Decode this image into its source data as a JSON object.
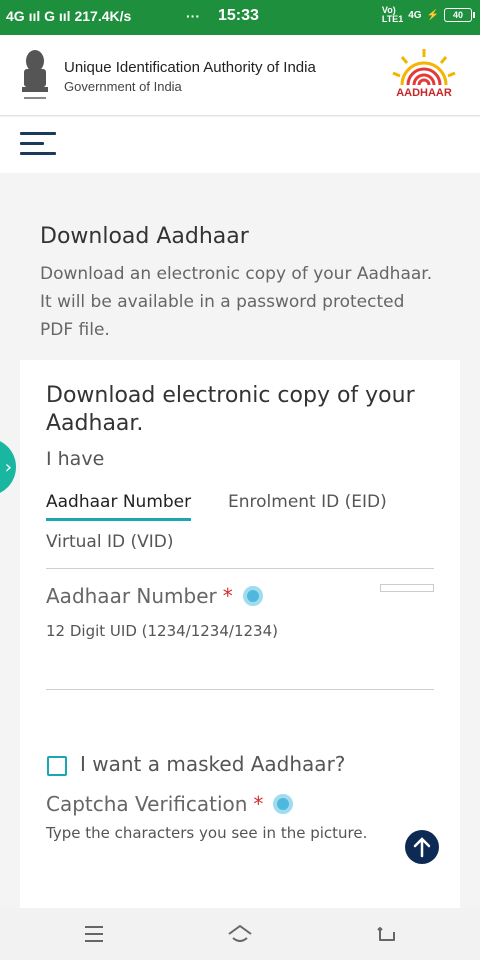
{
  "status_bar": {
    "left_text": "4G ııl  G ııl 217.4K/s",
    "dots": "···",
    "time": "15:33",
    "volte": "Vo)",
    "lte": "LTE1",
    "network": "4G",
    "battery": "40"
  },
  "header": {
    "org_name": "Unique Identification Authority of India",
    "org_sub": "Government of India",
    "logo_text": "AADHAAR"
  },
  "page": {
    "title": "Download Aadhaar",
    "description": "Download an electronic copy of your Aadhaar. It will be available in a password protected PDF file."
  },
  "card": {
    "title": "Download electronic copy of your Aadhaar.",
    "i_have": "I have",
    "tabs": [
      {
        "label": "Aadhaar Number",
        "active": true
      },
      {
        "label": "Enrolment ID (EID)",
        "active": false
      },
      {
        "label": "Virtual ID (VID)",
        "active": false
      }
    ],
    "aadhaar_field": {
      "label": "Aadhaar Number",
      "required_mark": "*",
      "hint": "12 Digit UID (1234/1234/1234)",
      "value": ""
    },
    "masked_checkbox": {
      "label": "I want a masked Aadhaar?",
      "checked": false
    },
    "captcha": {
      "label": "Captcha Verification",
      "required_mark": "*",
      "hint": "Type the characters you see in the picture."
    }
  },
  "colors": {
    "status_bar": "#1d8f3d",
    "accent": "#19a7b0",
    "required": "#d32f2f",
    "scroll_button": "#0d2a55",
    "side_tab": "#19b7a1"
  },
  "icons": {
    "side_tab": "chevron-right-icon",
    "scroll_top": "arrow-up-icon",
    "nav": [
      "menu-icon",
      "home-icon",
      "back-icon"
    ]
  }
}
